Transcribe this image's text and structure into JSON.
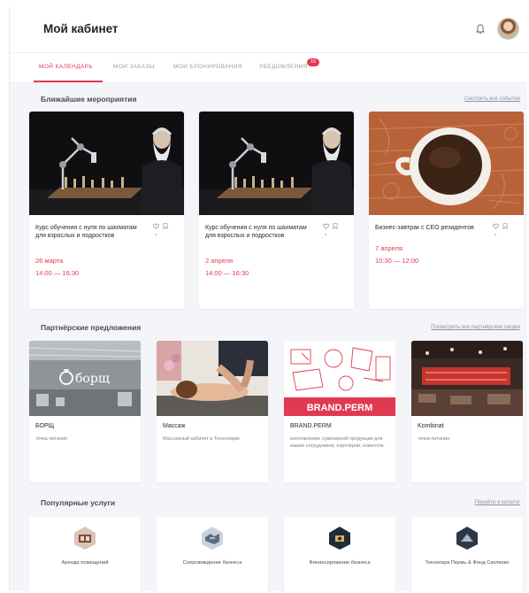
{
  "header": {
    "title": "Мой кабинет",
    "bell_icon": "bell-icon",
    "avatar_icon": "user-avatar"
  },
  "tabs": [
    {
      "label": "МОЙ КАЛЕНДАРЬ",
      "active": true
    },
    {
      "label": "МОИ ЗАКАЗЫ",
      "active": false
    },
    {
      "label": "МОИ БРОНИРОВАНИЯ",
      "active": false
    },
    {
      "label": "УВЕДОМЛЕНИЯ",
      "active": false,
      "badge": "16"
    }
  ],
  "events_section": {
    "title": "Ближайшие мероприятия",
    "link": "Смотреть все события",
    "items": [
      {
        "title": "Курс обучения с нуля по шахматам для взрослых и подростков",
        "date": "26 марта",
        "time": "14:00 — 16:30",
        "image": "chess-robot-photo"
      },
      {
        "title": "Курс обучения с нуля по шахматам для взрослых и подростков",
        "date": "2 апреля",
        "time": "14:00 — 16:30",
        "image": "chess-robot-photo"
      },
      {
        "title": "Бизнес-завтрак с CEO резидентов",
        "date": "7 апреля",
        "time": "10:30 — 12:00",
        "image": "coffee-cup-photo"
      }
    ]
  },
  "partners_section": {
    "title": "Партнёрские предложения",
    "link": "Посмотреть все партнёрские скидки",
    "items": [
      {
        "name": "БОРЩ",
        "desc": "точка питания",
        "image": "borsch-cafe-photo",
        "logo_text": "борщ"
      },
      {
        "name": "Массаж",
        "desc": "Массажный кабинет в Технопарке",
        "image": "massage-photo"
      },
      {
        "name": "BRAND.PERM",
        "desc": "изготовление сувенирной продукции для ваших сотрудников, партнёров, клиентов.",
        "image": "brand-perm-banner",
        "logo_text": "BRAND.PERM"
      },
      {
        "name": "Kombinat",
        "desc": "точка питания",
        "image": "kombinat-hall-photo"
      }
    ]
  },
  "services_section": {
    "title": "Популярные услуги",
    "link": "Перейти в каталог",
    "items": [
      {
        "label": "Аренда помещений",
        "icon": "office-room-icon"
      },
      {
        "label": "Сопровождение бизнеса",
        "icon": "handshake-icon"
      },
      {
        "label": "Финансирование бизнеса",
        "icon": "finance-icon"
      },
      {
        "label": "Технопарк Пермь & Фонд Сколково",
        "icon": "technopark-building-icon"
      }
    ]
  },
  "colors": {
    "accent": "#e03a51",
    "background": "#f4f5f9",
    "card": "#ffffff",
    "text": "#2b2b33",
    "muted": "#8d929c"
  }
}
